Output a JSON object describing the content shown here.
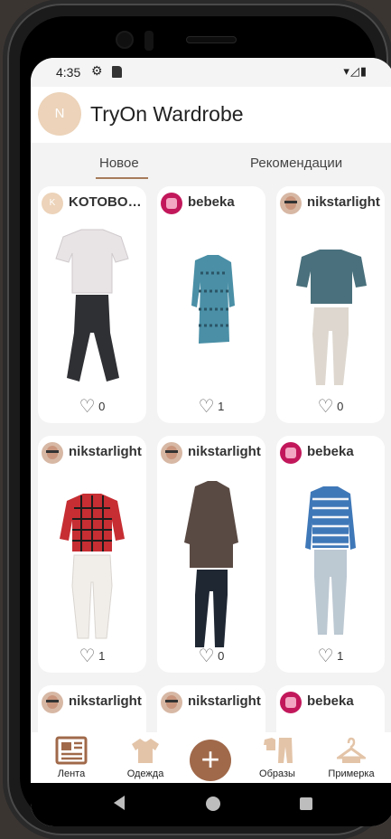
{
  "status_bar": {
    "time": "4:35",
    "icons": [
      "settings-icon",
      "sd-card-icon",
      "wifi-icon",
      "signal-icon",
      "battery-icon"
    ]
  },
  "app": {
    "title": "TryOn Wardrobe",
    "avatar_letter": "N"
  },
  "tabs": [
    {
      "label": "Новое",
      "active": true
    },
    {
      "label": "Рекомендации",
      "active": false
    }
  ],
  "feed": [
    {
      "user": "KOTOBOKCbI",
      "avatar": "letter",
      "avatar_letter": "K",
      "likes": "0"
    },
    {
      "user": "bebeka",
      "avatar": "pink",
      "likes": "1"
    },
    {
      "user": "nikstarlight",
      "avatar": "face",
      "likes": "0"
    },
    {
      "user": "nikstarlight",
      "avatar": "face",
      "likes": "1"
    },
    {
      "user": "nikstarlight",
      "avatar": "face",
      "likes": "0"
    },
    {
      "user": "bebeka",
      "avatar": "pink",
      "likes": "1"
    },
    {
      "user": "nikstarlight",
      "avatar": "face",
      "likes": ""
    },
    {
      "user": "nikstarlight",
      "avatar": "face",
      "likes": ""
    },
    {
      "user": "bebeka",
      "avatar": "pink",
      "likes": ""
    }
  ],
  "bottom_nav": [
    {
      "label": "Лента",
      "icon": "feed-icon"
    },
    {
      "label": "Одежда",
      "icon": "tshirt-icon"
    },
    {
      "label": "",
      "icon": "plus-icon"
    },
    {
      "label": "Образы",
      "icon": "outfits-icon"
    },
    {
      "label": "Примерка",
      "icon": "hanger-icon"
    }
  ],
  "colors": {
    "accent": "#a0694a",
    "avatar_bg": "#ecd3b9",
    "tab_underline": "#a67c5b"
  }
}
